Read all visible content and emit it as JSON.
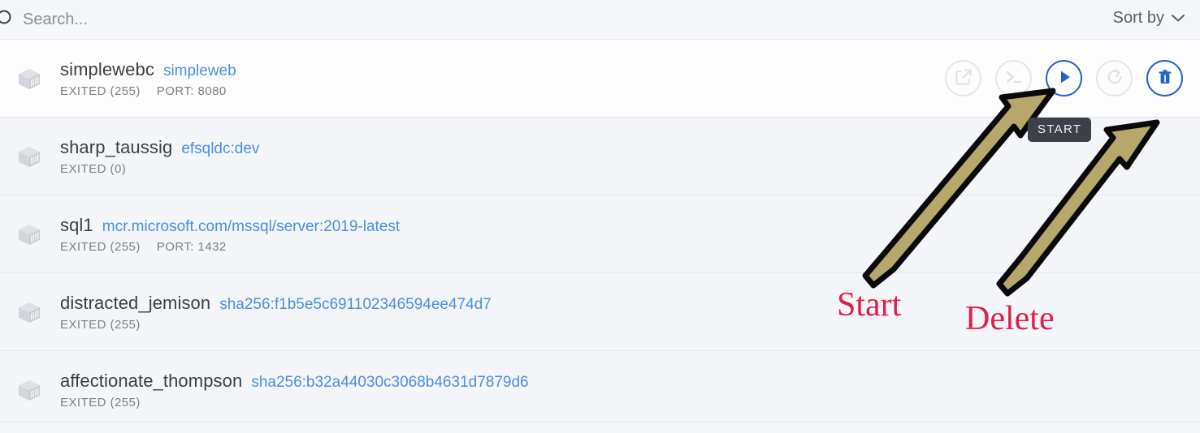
{
  "topbar": {
    "search_placeholder": "Search...",
    "search_value": "",
    "search_icon": "search-icon",
    "sort_label": "Sort by",
    "sort_chevron_icon": "chevron-down-icon"
  },
  "colors": {
    "accent_blue": "#2563c9",
    "link_blue": "#4a90e2",
    "row_bg": "#f4f5f9",
    "row_bg_active": "#fdfdfe",
    "disabled_border": "#e6e7ea",
    "annotation_red": "#e01e4e",
    "arrow_fill": "#b5a86a",
    "arrow_stroke": "#000000",
    "tooltip_bg": "#3b4049"
  },
  "tooltip": {
    "text": "START"
  },
  "actions": {
    "open_label": "Open in browser",
    "open_icon": "external-link-icon",
    "cli_label": "CLI",
    "cli_icon": "terminal-icon",
    "start_label": "Start",
    "start_icon": "play-icon",
    "restart_label": "Restart",
    "restart_icon": "restart-icon",
    "delete_label": "Delete",
    "delete_icon": "trash-icon"
  },
  "containers": [
    {
      "icon": "container-cube-icon",
      "name": "simplewebc",
      "image": "simpleweb",
      "status": "EXITED (255)",
      "port": "PORT: 8080",
      "highlighted": true,
      "buttons": [
        {
          "icon": "external-link-icon",
          "name": "open-in-browser-button",
          "enabled": false
        },
        {
          "icon": "terminal-icon",
          "name": "cli-button",
          "enabled": false
        },
        {
          "icon": "play-icon",
          "name": "start-button",
          "enabled": true
        },
        {
          "icon": "restart-icon",
          "name": "restart-button",
          "enabled": false
        },
        {
          "icon": "trash-icon",
          "name": "delete-button",
          "enabled": true
        }
      ]
    },
    {
      "icon": "container-cube-icon",
      "name": "sharp_taussig",
      "image": "efsqldc:dev",
      "status": "EXITED (0)",
      "port": "",
      "highlighted": false,
      "buttons": []
    },
    {
      "icon": "container-cube-icon",
      "name": "sql1",
      "image": "mcr.microsoft.com/mssql/server:2019-latest",
      "status": "EXITED (255)",
      "port": "PORT: 1432",
      "highlighted": false,
      "buttons": []
    },
    {
      "icon": "container-cube-icon",
      "name": "distracted_jemison",
      "image": "sha256:f1b5e5c691102346594ee474d7",
      "status": "EXITED (255)",
      "port": "",
      "highlighted": false,
      "buttons": []
    },
    {
      "icon": "container-cube-icon",
      "name": "affectionate_thompson",
      "image": "sha256:b32a44030c3068b4631d7879d6",
      "status": "EXITED (255)",
      "port": "",
      "highlighted": false,
      "buttons": []
    }
  ],
  "annotations": [
    {
      "id": "start",
      "text": "Start",
      "points_to": "start-button"
    },
    {
      "id": "delete",
      "text": "Delete",
      "points_to": "delete-button"
    }
  ]
}
